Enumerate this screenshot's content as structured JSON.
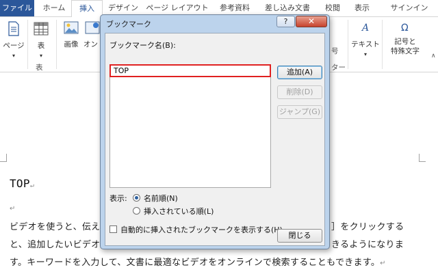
{
  "ribbon_tabs": [
    "ファイル",
    "ホーム",
    "挿入",
    "デザイン",
    "ページ レイアウト",
    "参考資料",
    "差し込み文書",
    "校閲",
    "表示",
    "サインイン"
  ],
  "ribbon": {
    "page_label": "ページ",
    "table_label": "表",
    "table_group_label": "表",
    "image_label": "画像",
    "online_image_label": "オンライ画像",
    "number_label": "号",
    "footer_label": "ター",
    "text_label": "テキスト",
    "symbols_label_line1": "記号と",
    "symbols_label_line2": "特殊文字"
  },
  "dialog": {
    "title": "ブックマーク",
    "help_label": "?",
    "close_label": "✕",
    "name_label": "ブックマーク名(B):",
    "name_value": "TOP",
    "bookmark_items": [],
    "add_button": "追加(A)",
    "delete_button": "削除(D)",
    "jump_button": "ジャンプ(G)",
    "sort_label": "表示:",
    "sort_options": [
      "名前順(N)",
      "挿入されている順(L)"
    ],
    "sort_selected": "名前順(N)",
    "hidden_label": "自動的に挿入されたブックマークを表示する(H)",
    "hidden_checked": false,
    "close_button": "閉じる"
  },
  "document": {
    "heading": "TOP",
    "line1_left": "ビデオを使うと、伝え",
    "line1_right": "］をクリックする",
    "line2_left": "と、追加したいビデオ",
    "line2_right": "きるようになりま",
    "line3": "す。キーワードを入力して、文書に最適なビデオをオンラインで検索することもできます。"
  },
  "colors": {
    "file_tab": "#2b579a",
    "accent": "#2b579a",
    "dialog_frame": "#bcd3ec",
    "highlight_box": "#e02020"
  }
}
